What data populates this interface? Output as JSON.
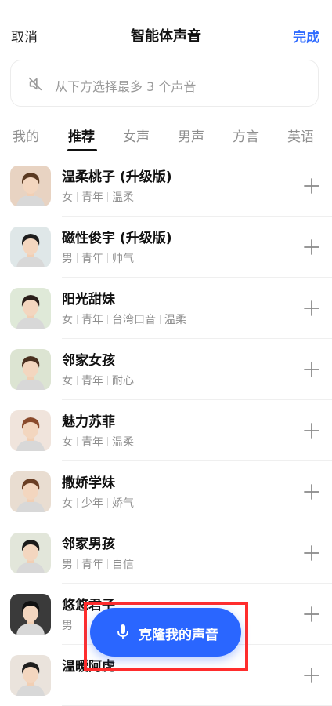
{
  "header": {
    "cancel": "取消",
    "title": "智能体声音",
    "done": "完成"
  },
  "select_box": {
    "icon": "mute-icon",
    "hint": "从下方选择最多 3 个声音"
  },
  "tabs": [
    "我的",
    "推荐",
    "女声",
    "男声",
    "方言",
    "英语"
  ],
  "active_tab": "推荐",
  "voices": [
    {
      "name": "温柔桃子 (升级版)",
      "tags": [
        "女",
        "青年",
        "温柔"
      ],
      "avatar_color": "#e8d3c2",
      "hair": "#5a3a22"
    },
    {
      "name": "磁性俊宇 (升级版)",
      "tags": [
        "男",
        "青年",
        "帅气"
      ],
      "avatar_color": "#dfe7e8",
      "hair": "#1d1d1d"
    },
    {
      "name": "阳光甜妹",
      "tags": [
        "女",
        "青年",
        "台湾口音",
        "温柔"
      ],
      "avatar_color": "#dfe9d8",
      "hair": "#2a1e1a"
    },
    {
      "name": "邻家女孩",
      "tags": [
        "女",
        "青年",
        "耐心"
      ],
      "avatar_color": "#dce4d2",
      "hair": "#4a3020"
    },
    {
      "name": "魅力苏菲",
      "tags": [
        "女",
        "青年",
        "温柔"
      ],
      "avatar_color": "#f0e4dc",
      "hair": "#8a4a2c"
    },
    {
      "name": "撒娇学妹",
      "tags": [
        "女",
        "少年",
        "娇气"
      ],
      "avatar_color": "#e9ddd1",
      "hair": "#6a3e24"
    },
    {
      "name": "邻家男孩",
      "tags": [
        "男",
        "青年",
        "自信"
      ],
      "avatar_color": "#e2e6da",
      "hair": "#1a1a1a"
    },
    {
      "name": "悠悠君子",
      "tags": [
        "男"
      ],
      "avatar_color": "#3a3a3a",
      "hair": "#111111"
    },
    {
      "name": "温暖阿虎",
      "tags": [],
      "avatar_color": "#eae3dc",
      "hair": "#1e1e1e"
    }
  ],
  "clone_button": {
    "label": "克隆我的声音",
    "icon": "microphone-icon"
  },
  "colors": {
    "accent": "#2a66ff",
    "highlight_frame": "#ff2d2d",
    "done_text": "#2f6bff"
  }
}
